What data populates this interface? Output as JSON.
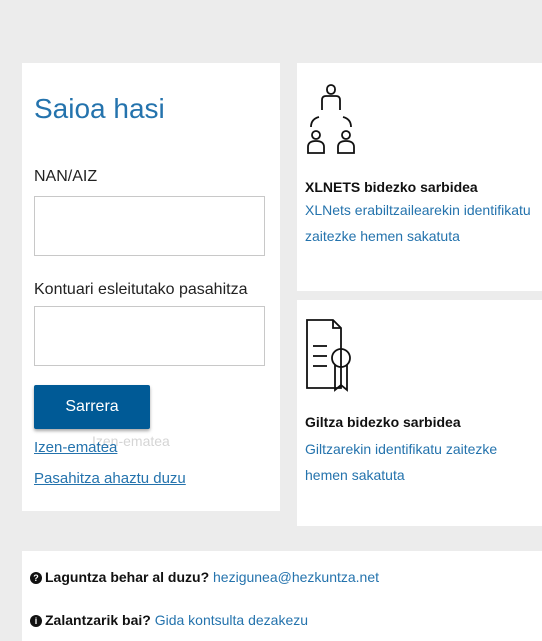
{
  "login": {
    "title": "Saioa hasi",
    "id_label": "NAN/AIZ",
    "id_value": "",
    "password_label": "Kontuari esleitutako pasahitza",
    "password_value": "",
    "submit_label": "Sarrera",
    "register_link": "Izen-ematea",
    "register_ghost": "Izen-ematea",
    "forgot_link": "Pasahitza ahaztu duzu"
  },
  "xlnets": {
    "icon": "user-network-icon",
    "title": "XLNETS bidezko sarbidea",
    "description": "XLNets erabiltzailearekin identifikatu zaitezke hemen sakatuta"
  },
  "giltza": {
    "icon": "certificate-icon",
    "title": "Giltza bidezko sarbidea",
    "description": "Giltzarekin identifikatu zaitezke hemen sakatuta"
  },
  "help": {
    "help_icon": "question-circle-icon",
    "help_question": "Laguntza behar al duzu?",
    "help_email": "hezigunea@hezkuntza.net",
    "doubts_icon": "info-circle-icon",
    "doubts_question": "Zalantzarik bai?",
    "doubts_link": "Gida kontsulta dezakezu"
  },
  "colors": {
    "background": "#ececec",
    "accent": "#2473ad",
    "button": "#005a96"
  }
}
